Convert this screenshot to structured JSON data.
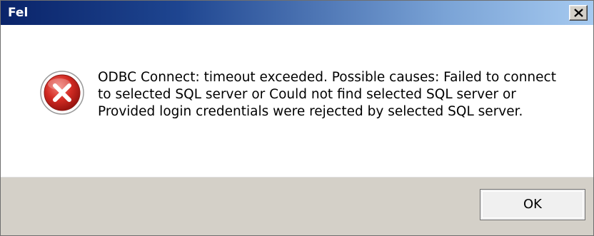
{
  "window": {
    "title": "Fel",
    "close_label": "Close",
    "close_icon": "close-icon"
  },
  "dialog": {
    "icon": "error-icon",
    "message": "ODBC Connect: timeout exceeded. Possible causes: Failed to connect to selected SQL server or Could not find selected SQL server or Provided login credentials were rejected by selected SQL server.",
    "ok_label": "OK"
  },
  "colors": {
    "titlebar_start": "#0a246a",
    "titlebar_end": "#a6caf0",
    "error_red": "#c8201d",
    "button_face": "#d4d0c8"
  }
}
